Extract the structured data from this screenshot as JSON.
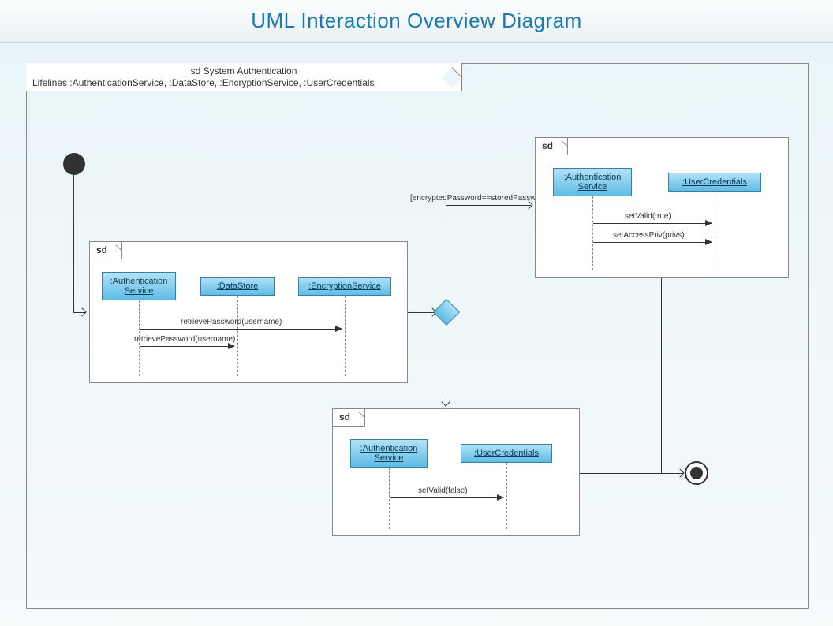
{
  "title": "UML Interaction Overview Diagram",
  "main_frame": {
    "label_line1": "sd System Authentication",
    "label_line2": "Lifelines :AuthenticationService, :DataStore, :EncryptionService, :UserCredentials"
  },
  "sd_label": "sd",
  "guard": "[encryptedPassword==storedPassword]",
  "sd1": {
    "lifelines": [
      ":Authentication Service",
      ":DataStore",
      ":EncryptionService"
    ],
    "msg1": "retrievePassword(username)",
    "msg2": "retrievePassword(username)"
  },
  "sd2": {
    "lifelines": [
      ":Authentication Service",
      ":UserCredentials"
    ],
    "msg1": "setValid(true)",
    "msg2": "setAccessPriv(privs)"
  },
  "sd3": {
    "lifelines": [
      ":Authentication Service",
      ":UserCredentials"
    ],
    "msg1": "setValid(false)"
  }
}
